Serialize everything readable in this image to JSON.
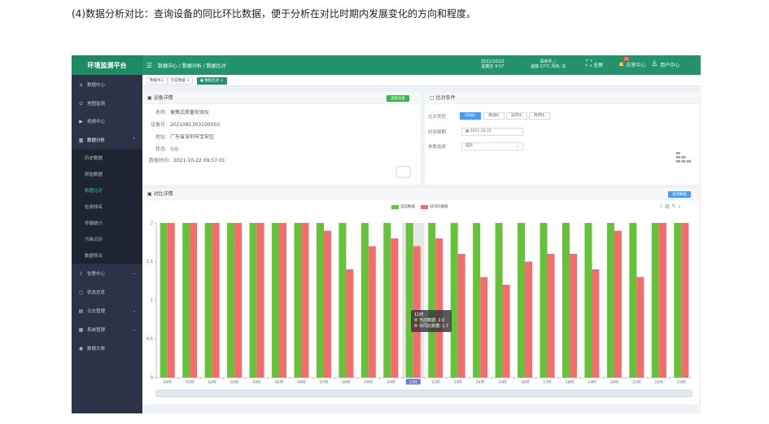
{
  "caption": "(4)数据分析对比：查询设备的同比环比数据，便于分析在对比时期内发展变化的方向和程度。",
  "header": {
    "app_title": "环境监测平台",
    "breadcrumb": "数据中心 / 数据分析 / 数据比对",
    "date": "2021/10/22",
    "weekday_time": "星期五 9:57",
    "city": "深圳市 ◌",
    "weather": "温度:17℃ 风向: 东",
    "fullscreen_label": "全屏",
    "alarm_label": "告警中心",
    "alarm_count": "20",
    "user_label": "用户中心"
  },
  "sidebar": {
    "items": [
      {
        "label": "数据中心",
        "icon": "home-icon"
      },
      {
        "label": "地图监测",
        "icon": "location-icon"
      },
      {
        "label": "视频中心",
        "icon": "video-icon"
      },
      {
        "label": "数据分析",
        "icon": "chart-icon"
      }
    ],
    "sub_items": [
      "历史数据",
      "原始数据",
      "数据比对",
      "检测排名",
      "传输统计",
      "污染日历",
      "数据导出"
    ],
    "active_sub": "数据比对",
    "items_after": [
      {
        "label": "告警中心",
        "icon": "bell-icon"
      },
      {
        "label": "状态总览",
        "icon": "circle-icon"
      },
      {
        "label": "日志管理",
        "icon": "log-icon"
      },
      {
        "label": "系统管理",
        "icon": "settings-icon"
      },
      {
        "label": "数据大屏",
        "icon": "screen-icon"
      }
    ]
  },
  "tabs": [
    "数据中心",
    "历史数据 ×",
    "● 数据比对 ×"
  ],
  "device": {
    "title": "设备详情",
    "select_btn": "选择设备",
    "name_label": "名称:",
    "name": "便携式质量检测仪",
    "code_label": "设备号:",
    "code": "2021081303100003",
    "addr_label": "地址:",
    "addr": "广东省深圳市宝安区",
    "status_label": "状态:",
    "status": "在线",
    "time_label": "数据时间:",
    "time": "2021-10-22 09:57:01"
  },
  "compare": {
    "title": "比对条件",
    "type_label": "比对类型",
    "types": [
      "日同比",
      "月同比",
      "日环比",
      "月环比"
    ],
    "active_type": "日同比",
    "time_label": "时间周期",
    "date_value": "2021-10-21",
    "param_label": "参数选择",
    "param_value": "噪声"
  },
  "chart_panel": {
    "title": "对比详情",
    "query_btn": "查询数据",
    "tooltip": {
      "title": "11时",
      "current": "当前数据: 2.0",
      "previous": "日同比数据: 1.7"
    }
  },
  "colors": {
    "current": "#66c23a",
    "previous": "#f56c6c",
    "brand": "#23936b"
  },
  "chart_data": {
    "type": "bar",
    "categories": [
      "00时",
      "01时",
      "02时",
      "03时",
      "04时",
      "05时",
      "06时",
      "07时",
      "08时",
      "09时",
      "10时",
      "11时",
      "12时",
      "13时",
      "14时",
      "15时",
      "16时",
      "17时",
      "18时",
      "19时",
      "20时",
      "21时",
      "22时",
      "23时"
    ],
    "series": [
      {
        "name": "当前数据",
        "values": [
          2,
          2,
          2,
          2,
          2,
          2,
          2,
          2,
          2,
          2,
          2,
          2,
          2,
          2,
          2,
          2,
          2,
          2,
          2,
          2,
          2,
          2,
          2,
          2
        ]
      },
      {
        "name": "日同比数据",
        "values": [
          2,
          2,
          2,
          2,
          2,
          2,
          2,
          1.9,
          1.4,
          1.7,
          1.8,
          1.7,
          1.8,
          1.6,
          1.3,
          1.2,
          1.5,
          1.6,
          1.6,
          1.4,
          1.9,
          1.3,
          2,
          2
        ]
      }
    ],
    "yticks": [
      "0",
      "0.5",
      "1",
      "1.5",
      "2"
    ],
    "ylim": [
      0,
      2
    ],
    "highlight_category": "11时",
    "legend_position": "top-center",
    "grid": false
  }
}
